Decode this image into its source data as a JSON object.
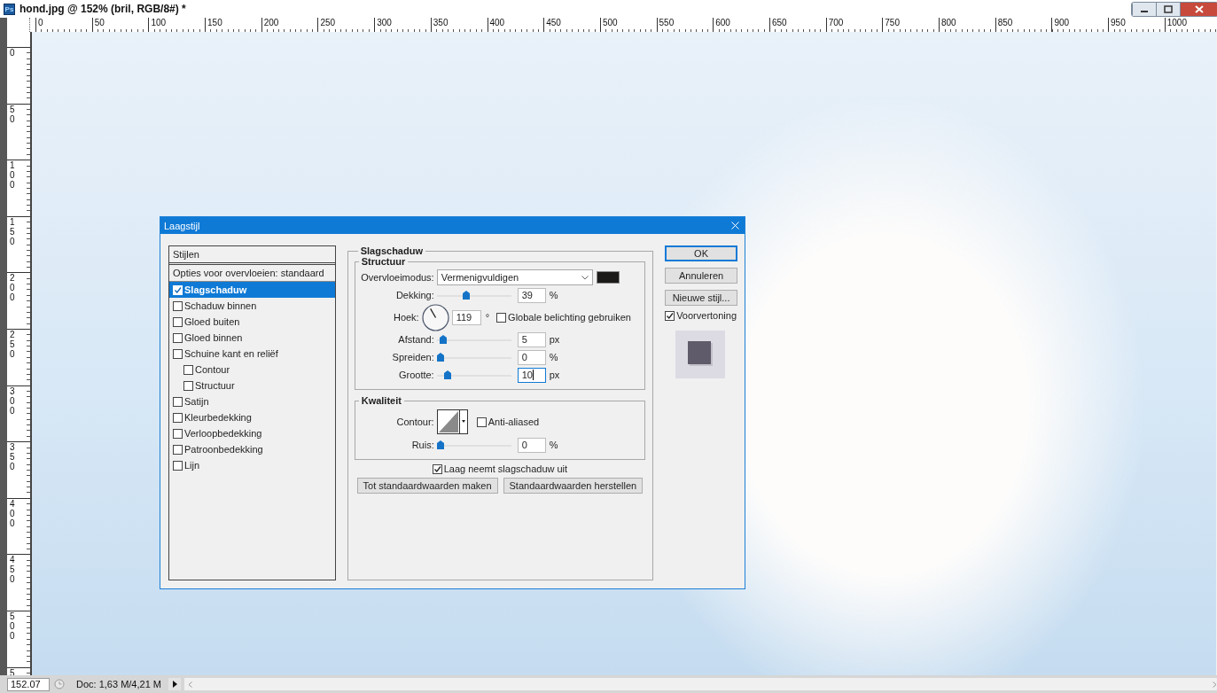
{
  "window": {
    "icon_text": "Ps",
    "title": "hond.jpg @ 152% (bril, RGB/8#) *"
  },
  "ruler_top": {
    "labels": [
      "0",
      "50",
      "100",
      "150",
      "200",
      "250",
      "300",
      "350",
      "400",
      "450",
      "500",
      "550",
      "600",
      "650",
      "700",
      "750",
      "800",
      "850",
      "900",
      "950",
      "1000"
    ]
  },
  "ruler_left": {
    "labels": [
      "0",
      "50",
      "100",
      "150",
      "200",
      "250",
      "300",
      "350",
      "400",
      "450",
      "500",
      "5"
    ]
  },
  "status_bar": {
    "zoom": "152.07",
    "doc_info": "Doc: 1,63 M/4,21 M"
  },
  "dialog": {
    "title": "Laagstijl",
    "styles_header": "Stijlen",
    "blending_options": "Opties voor overvloeien: standaard",
    "styles": [
      {
        "label": "Slagschaduw",
        "checked": true,
        "selected": true
      },
      {
        "label": "Schaduw binnen",
        "checked": false,
        "selected": false
      },
      {
        "label": "Gloed buiten",
        "checked": false,
        "selected": false
      },
      {
        "label": "Gloed binnen",
        "checked": false,
        "selected": false
      },
      {
        "label": "Schuine kant en reliëf",
        "checked": false,
        "selected": false,
        "children": [
          {
            "label": "Contour",
            "checked": false,
            "selected": false
          },
          {
            "label": "Structuur",
            "checked": false,
            "selected": false
          }
        ]
      },
      {
        "label": "Satijn",
        "checked": false,
        "selected": false
      },
      {
        "label": "Kleurbedekking",
        "checked": false,
        "selected": false
      },
      {
        "label": "Verloopbedekking",
        "checked": false,
        "selected": false
      },
      {
        "label": "Patroonbedekking",
        "checked": false,
        "selected": false
      },
      {
        "label": "Lijn",
        "checked": false,
        "selected": false
      }
    ],
    "panel_title": "Slagschaduw",
    "structure": {
      "title": "Structuur",
      "blend_mode": {
        "label": "Overvloeimodus:",
        "value": "Vermenigvuldigen",
        "color": "#1c1a19"
      },
      "rows": [
        {
          "kind": "slider",
          "label": "Dekking:",
          "level": 0.39,
          "value": "39",
          "unit": "%",
          "focused": false
        },
        {
          "kind": "angle",
          "label": "Hoek:",
          "value": "119",
          "unit": "°",
          "focused": false,
          "checkbox": {
            "label": "Globale belichting gebruiken",
            "checked": false
          }
        },
        {
          "kind": "slider",
          "label": "Afstand:",
          "level": 0.05,
          "value": "5",
          "unit": "px",
          "focused": false
        },
        {
          "kind": "slider",
          "label": "Spreiden:",
          "level": 0,
          "value": "0",
          "unit": "%",
          "focused": false
        },
        {
          "kind": "slider",
          "label": "Grootte:",
          "level": 0.11,
          "value": "10",
          "unit": "px",
          "focused": true
        }
      ]
    },
    "quality": {
      "title": "Kwaliteit",
      "rows": [
        {
          "kind": "contour",
          "label": "Contour:",
          "checkbox": {
            "label": "Anti-aliased",
            "checked": false
          }
        },
        {
          "kind": "slider",
          "label": "Ruis:",
          "level": 0,
          "value": "0",
          "unit": "%",
          "focused": false
        }
      ]
    },
    "knockout": {
      "label": "Laag neemt slagschaduw uit",
      "checked": true
    },
    "default_buttons": [
      "Tot standaardwaarden maken",
      "Standaardwaarden herstellen"
    ],
    "buttons": [
      {
        "label": "OK",
        "default": true
      },
      {
        "label": "Annuleren",
        "default": false
      },
      {
        "label": "Nieuwe stijl...",
        "default": false
      }
    ],
    "preview": {
      "label": "Voorvertoning",
      "checked": true
    }
  }
}
